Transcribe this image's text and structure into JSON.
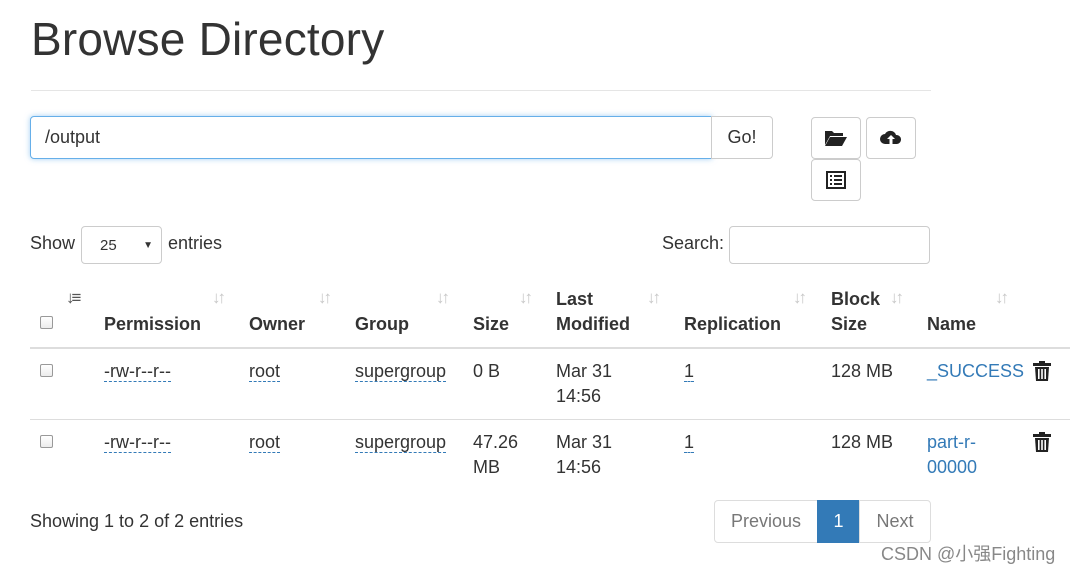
{
  "page": {
    "title": "Browse Directory"
  },
  "path_bar": {
    "value": "/output",
    "go_label": "Go!"
  },
  "toolbar": {
    "icons": [
      "folder-open-icon",
      "cloud-upload-icon",
      "list-alt-icon"
    ]
  },
  "table_controls": {
    "show_label": "Show",
    "entries_value": "25",
    "entries_label": "entries",
    "search_label": "Search:",
    "search_value": ""
  },
  "table": {
    "headers": [
      {
        "line1": "",
        "line2": "Permission"
      },
      {
        "line1": "",
        "line2": "Owner"
      },
      {
        "line1": "",
        "line2": "Group"
      },
      {
        "line1": "",
        "line2": "Size"
      },
      {
        "line1": "Last",
        "line2": "Modified"
      },
      {
        "line1": "",
        "line2": "Replication"
      },
      {
        "line1": "Block",
        "line2": "Size"
      },
      {
        "line1": "",
        "line2": "Name"
      }
    ],
    "rows": [
      {
        "permission": "-rw-r--r--",
        "owner": "root",
        "group": "supergroup",
        "size_line1": "0 B",
        "size_line2": "",
        "modified_line1": "Mar 31",
        "modified_line2": "14:56",
        "replication": "1",
        "block_size": "128 MB",
        "name_line1": "_SUCCESS",
        "name_line2": ""
      },
      {
        "permission": "-rw-r--r--",
        "owner": "root",
        "group": "supergroup",
        "size_line1": "47.26",
        "size_line2": "MB",
        "modified_line1": "Mar 31",
        "modified_line2": "14:56",
        "replication": "1",
        "block_size": "128 MB",
        "name_line1": "part-r-",
        "name_line2": "00000"
      }
    ]
  },
  "footer": {
    "info": "Showing 1 to 2 of 2 entries",
    "pagination": {
      "previous": "Previous",
      "current": "1",
      "next": "Next"
    }
  },
  "watermark": "CSDN @小强Fighting",
  "colors": {
    "link": "#337ab7",
    "focus": "#66afe9",
    "active_page": "#337ab7"
  }
}
